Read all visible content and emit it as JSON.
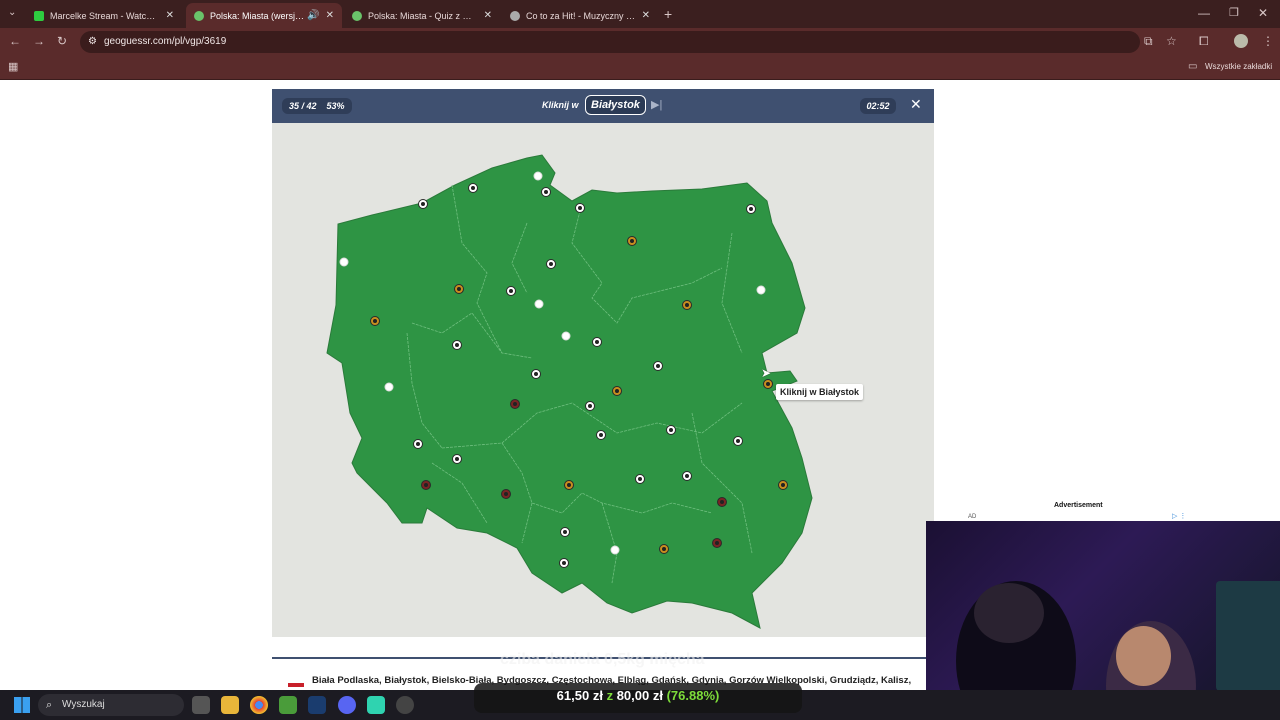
{
  "browser": {
    "tabs": [
      {
        "title": "Marcelke Stream - Watch Live o",
        "active": false
      },
      {
        "title": "Polska: Miasta (wersja trudn",
        "active": true
      },
      {
        "title": "Polska: Miasta - Quiz z mapą -",
        "active": false
      },
      {
        "title": "Co to za Hit! - Muzyczny Quiz",
        "active": false
      }
    ],
    "url": "geoguessr.com/pl/vgp/3619",
    "bookmarks_label": "Wszystkie zakładki"
  },
  "game": {
    "progress": "35 / 42",
    "accuracy": "53%",
    "prompt_prefix": "Kliknij w",
    "target": "Białystok",
    "timer": "02:52",
    "tooltip": "Kliknij w Białystok"
  },
  "map_markers": {
    "colors": {
      "correct": "#ffffff",
      "attempt2": "#c88e1f",
      "wrong": "#7a2424"
    }
  },
  "overlay": {
    "caption": "cziba daniela 0,5kg mięcha",
    "price_now": "61,50 zł",
    "price_sep": "z",
    "price_total": "80,00 zł",
    "price_pct": "(76.88%)"
  },
  "footer": {
    "cities": "Biała Podlaska, Białystok, Bielsko-Biała, Bydgoszcz, Częstochowa, Elbląg, Gdańsk, Gdynia, Gorzów Wielkopolski, Grudziądz, Kalisz, Katowice,"
  },
  "ad": {
    "label": "Advertisement",
    "tag": "AD"
  },
  "taskbar": {
    "search_placeholder": "Wyszukaj"
  }
}
